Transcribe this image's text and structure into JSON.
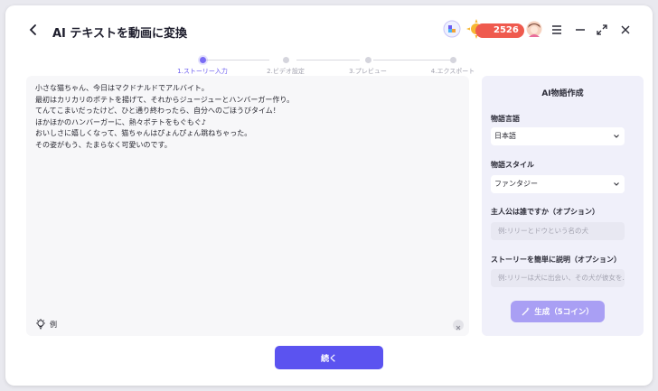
{
  "header": {
    "title": "AI テキストを動画に変換",
    "coins": "2526"
  },
  "steps": [
    {
      "label": "1.ストーリー入力",
      "active": true
    },
    {
      "label": "2.ビデオ設定",
      "active": false
    },
    {
      "label": "3.プレビュー",
      "active": false
    },
    {
      "label": "4.エクスポート",
      "active": false
    }
  ],
  "editor": {
    "story": "小さな猫ちゃん、今日はマクドナルドでアルバイト。\n最初はカリカリのポテトを揚げて、それからジュージューとハンバーガー作り。\nてんてこまいだったけど、ひと通り終わったら、自分へのごほうびタイム！\nほかほかのハンバーガーに、熱々ポテトをもぐもぐ♪\nおいしさに嬉しくなって、猫ちゃんはぴょんぴょん跳ねちゃった。\nその姿がもう、たまらなく可愛いのです。",
    "example_label": "例"
  },
  "side": {
    "title": "AI物語作成",
    "language_label": "物語言語",
    "language_value": "日本語",
    "style_label": "物語スタイル",
    "style_value": "ファンタジー",
    "protagonist_label": "主人公は誰ですか（オプション）",
    "protagonist_placeholder": "例:リリーとドウという名の犬",
    "description_label": "ストーリーを簡単に説明（オプション）",
    "description_placeholder": "例:リリーは犬に出会い、その犬が彼女を...",
    "generate_label": "生成（5コイン）"
  },
  "footer": {
    "continue_label": "続く"
  },
  "colors": {
    "accent": "#5b53f0",
    "generate": "#a99ff4",
    "coin_badge": "#ef5a4e"
  }
}
